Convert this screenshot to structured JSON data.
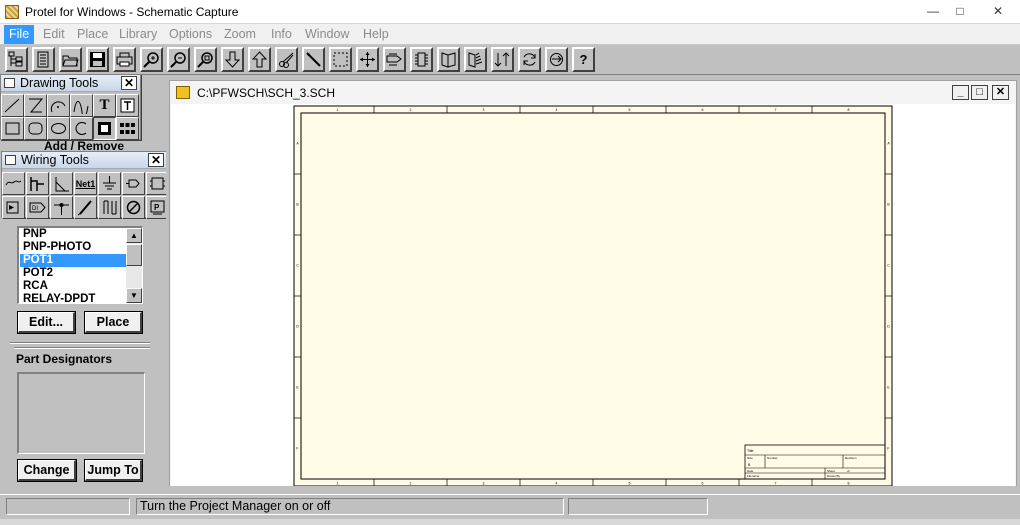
{
  "app": {
    "title": "Protel for Windows - Schematic Capture",
    "icon": "schematic-app-icon"
  },
  "window_controls": {
    "minimize": "—",
    "maximize": "□",
    "close": "✕"
  },
  "menu": [
    {
      "label": "File",
      "active": true
    },
    {
      "label": "Edit"
    },
    {
      "label": "Place"
    },
    {
      "label": "Library"
    },
    {
      "label": "Options"
    },
    {
      "label": "Zoom"
    },
    {
      "label": "Info"
    },
    {
      "label": "Window"
    },
    {
      "label": "Help"
    }
  ],
  "toolbar": {
    "buttons": [
      "project-manager",
      "open-file",
      "folder",
      "save",
      "print",
      "zoom-in",
      "zoom-out",
      "zoom-fit",
      "move-down",
      "move-up",
      "cut",
      "wire-tool",
      "select-area",
      "move-cross",
      "toolbar-10",
      "toolbar-11",
      "library-book",
      "library-open",
      "update-list",
      "repeat",
      "rotate",
      "help"
    ],
    "help_label": "?"
  },
  "drawing_tools": {
    "title": "Drawing Tools",
    "tools": [
      "line",
      "polygon",
      "arc",
      "bezier",
      "text",
      "text-frame",
      "rectangle",
      "rounded-rectangle",
      "ellipse",
      "pie",
      "image",
      "array"
    ],
    "text_glyph": "T"
  },
  "add_remove_label": "Add / Remove",
  "wiring_tools": {
    "title": "Wiring Tools",
    "tools": [
      "wire",
      "bus",
      "bus-entry",
      "net-label",
      "power-port",
      "port",
      "sheet-symbol",
      "sheet-entry",
      "directive",
      "junction",
      "no-erc",
      "block",
      "delete",
      "probe"
    ],
    "net_label": "Net1"
  },
  "library": {
    "parts": [
      "PNP",
      "PNP-PHOTO",
      "POT1",
      "POT2",
      "RCA",
      "RELAY-DPDT"
    ],
    "selected": "POT1",
    "edit_label": "Edit...",
    "place_label": "Place"
  },
  "part_designators": {
    "label": "Part Designators",
    "change_label": "Change",
    "jump_label": "Jump To"
  },
  "document": {
    "title": "C:\\PFWSCH\\SCH_3.SCH",
    "sheet_color": "#fffbe6",
    "border_color": "#000000",
    "columns": [
      "1",
      "2",
      "3",
      "4",
      "5",
      "6",
      "7",
      "8"
    ],
    "rows": [
      "A",
      "B",
      "C",
      "D",
      "E",
      "F"
    ],
    "title_block": {
      "title_label": "Title",
      "size_label": "Size",
      "number_label": "Number",
      "revision_label": "Revision",
      "date_label": "Date",
      "filename_label": "Filename",
      "sheet_label": "Sheet",
      "of_label": "of",
      "drawn_label": "Drawn By",
      "size_value": "B"
    }
  },
  "status": {
    "message": "Turn the Project Manager on or off"
  }
}
